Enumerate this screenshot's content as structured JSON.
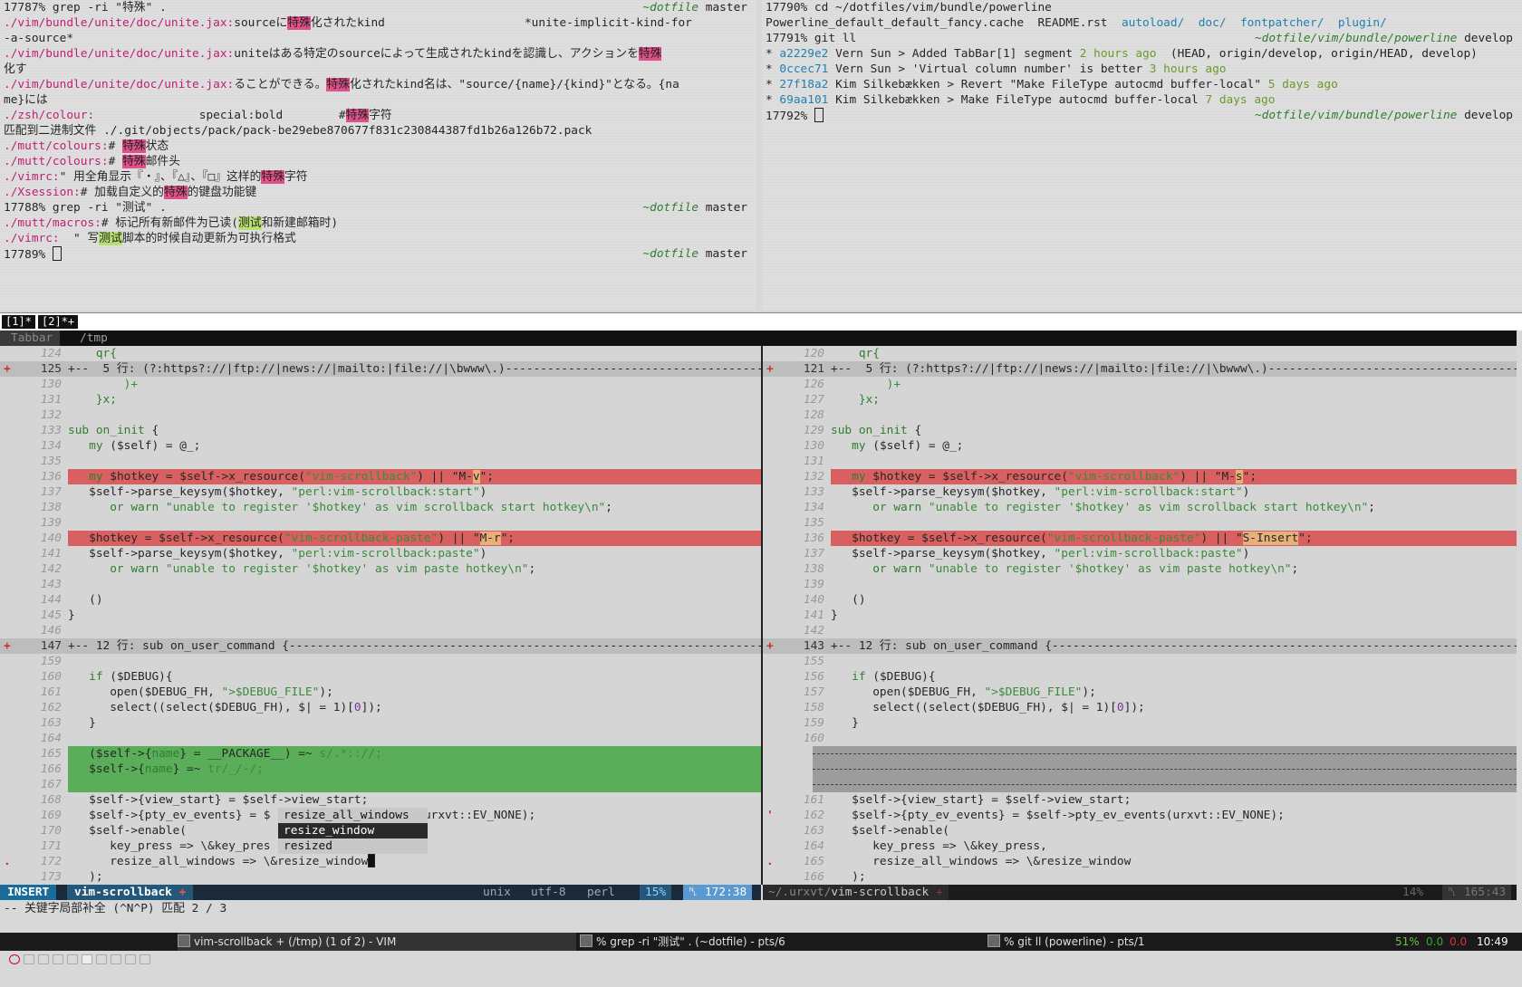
{
  "top_left_terminal": [
    [
      [
        "17787% grep -ri \"特殊\" .",
        ""
      ]
    ],
    [
      [
        "./vim/bundle/unite/doc/unite.jax:",
        "mag"
      ],
      [
        "source",
        ""
      ],
      [
        "に",
        ""
      ],
      [
        "特殊",
        "hl"
      ],
      [
        "化されたkind                    *unite-implicit-kind-for",
        ""
      ]
    ],
    [
      [
        "-a-source*",
        ""
      ]
    ],
    [
      [
        "./vim/bundle/unite/doc/unite.jax:",
        "mag"
      ],
      [
        "uniteはある特定のsourceによって生成されたkindを認識し、アクションを",
        ""
      ],
      [
        "特殊",
        "hl"
      ]
    ],
    [
      [
        "化す",
        ""
      ]
    ],
    [
      [
        "./vim/bundle/unite/doc/unite.jax:",
        "mag"
      ],
      [
        "ることができる。",
        ""
      ],
      [
        "特殊",
        "hl"
      ],
      [
        "化されたkind名は、\"source/{name}/{kind}\"となる。{na",
        ""
      ]
    ],
    [
      [
        "me}には",
        ""
      ]
    ],
    [
      [
        "./zsh/colour:",
        "mag"
      ],
      [
        "               special:bold        #",
        ""
      ],
      [
        "特殊",
        "hl"
      ],
      [
        "字符",
        ""
      ]
    ],
    [
      [
        "匹配到二进制文件 ./.git/objects/pack/pack-be29ebe870677f831c230844387fd1b26a126b72.pack",
        ""
      ]
    ],
    [
      [
        "./mutt/colours:",
        "mag"
      ],
      [
        "# ",
        ""
      ],
      [
        "特殊",
        "hl"
      ],
      [
        "状态",
        ""
      ]
    ],
    [
      [
        "./mutt/colours:",
        "mag"
      ],
      [
        "# ",
        ""
      ],
      [
        "特殊",
        "hl"
      ],
      [
        "邮件头",
        ""
      ]
    ],
    [
      [
        "./vimrc:",
        "mag"
      ],
      [
        "\" 用全角显示『・』、『△』、『□』这样的",
        ""
      ],
      [
        "特殊",
        "hl"
      ],
      [
        "字符",
        ""
      ]
    ],
    [
      [
        "./Xsession:",
        "mag"
      ],
      [
        "# 加载自定义的",
        ""
      ],
      [
        "特殊",
        "hl"
      ],
      [
        "的键盘功能键",
        ""
      ]
    ],
    [
      [
        "17788% grep -ri \"测试\" .",
        ""
      ]
    ],
    [
      [
        "./mutt/macros:",
        "mag"
      ],
      [
        "# 标记所有新邮件为已读(",
        ""
      ],
      [
        "测试",
        "hlg"
      ],
      [
        "和新建邮箱时)",
        ""
      ]
    ],
    [
      [
        "./vimrc:",
        "mag"
      ],
      [
        "  \" 写",
        ""
      ],
      [
        "测试",
        "hlg"
      ],
      [
        "脚本的时候自动更新为可执行格式",
        ""
      ]
    ],
    [
      [
        "17789% ",
        ""
      ]
    ]
  ],
  "top_left_prompts": {
    "1": "~dotfile master",
    "14": "~dotfile master",
    "17": "~dotfile master"
  },
  "top_left_branch": "master",
  "top_left_path": "~dotfile",
  "top_right_terminal": [
    [
      [
        "17790% cd ~/dotfiles/vim/bundle/powerline",
        ""
      ]
    ],
    [
      [
        "Powerline_default_default_fancy.cache  README.rst  ",
        ""
      ],
      [
        "autoload/",
        "cy"
      ],
      [
        "  ",
        ""
      ],
      [
        "doc/",
        "cy"
      ],
      [
        "  ",
        ""
      ],
      [
        "fontpatcher/",
        "cy"
      ],
      [
        "  ",
        ""
      ],
      [
        "plugin/",
        "cy"
      ]
    ],
    [
      [
        "17791% git ll",
        ""
      ]
    ],
    [
      [
        "* ",
        ""
      ],
      [
        "a2229e2",
        "hsh"
      ],
      [
        " Vern Sun > Added TabBar[1] segment ",
        ""
      ],
      [
        "2 hours ago",
        "dim"
      ],
      [
        "  (HEAD, origin/develop, origin/HEAD, develop)",
        "br"
      ]
    ],
    [
      [
        "* ",
        ""
      ],
      [
        "0ccec71",
        "hsh"
      ],
      [
        " Vern Sun > 'Virtual column number' is better ",
        ""
      ],
      [
        "3 hours ago",
        "dim"
      ]
    ],
    [
      [
        "* ",
        ""
      ],
      [
        "27f18a2",
        "hsh"
      ],
      [
        " Kim Silkebækken > Revert \"Make FileType autocmd buffer-local\" ",
        ""
      ],
      [
        "5 days ago",
        "dim"
      ]
    ],
    [
      [
        "* ",
        ""
      ],
      [
        "69aa101",
        "hsh"
      ],
      [
        " Kim Silkebækken > Make FileType autocmd buffer-local ",
        ""
      ],
      [
        "7 days ago",
        "dim"
      ]
    ],
    [
      [
        "17792% ",
        ""
      ]
    ]
  ],
  "top_right_prompts": {
    "3": "~dotfile/vim/bundle/powerline develop",
    "8": "~dotfile/vim/bundle/powerline develop"
  },
  "tabs": [
    "[1]*",
    "[2]*+"
  ],
  "tabbar": {
    "label": "Tabbar",
    "path": "/tmp"
  },
  "left_pane": [
    {
      "n": "124",
      "t": [
        [
          "    qr{",
          "kw"
        ]
      ]
    },
    {
      "n": "125",
      "s": "+",
      "fold": true,
      "t": [
        [
          "+--  5 行: (?:https?://|ftp://|news://|mailto:|file://|\\bwww\\.)-------------------------------------------",
          ""
        ]
      ]
    },
    {
      "n": "130",
      "t": [
        [
          "        )+",
          "str"
        ]
      ]
    },
    {
      "n": "131",
      "t": [
        [
          "    }x;",
          "kw"
        ]
      ]
    },
    {
      "n": "132",
      "t": []
    },
    {
      "n": "133",
      "t": [
        [
          "sub ",
          "kw"
        ],
        [
          "on_init",
          "kw"
        ],
        [
          " {",
          ""
        ]
      ]
    },
    {
      "n": "134",
      "t": [
        [
          "   my ",
          "kw"
        ],
        [
          "($self) = @_;",
          ""
        ]
      ]
    },
    {
      "n": "135",
      "t": []
    },
    {
      "n": "136",
      "chg": true,
      "t": [
        [
          "   my ",
          "kw"
        ],
        [
          "$hotkey = $self->x_resource(",
          ""
        ],
        [
          "\"vim-scrollback\"",
          "str"
        ],
        [
          ") || ",
          ""
        ],
        [
          "\"M-",
          ""
        ],
        [
          "v",
          "dhl"
        ],
        [
          "\";",
          ""
        ]
      ]
    },
    {
      "n": "137",
      "t": [
        [
          "   $self->parse_keysym($hotkey, ",
          ""
        ],
        [
          "\"perl:vim-scrollback:start\"",
          "str"
        ],
        [
          ")",
          ""
        ]
      ]
    },
    {
      "n": "138",
      "t": [
        [
          "      or warn ",
          "kw"
        ],
        [
          "\"unable to register '$hotkey' as vim scrollback start hotkey\\n\"",
          "str"
        ],
        [
          ";",
          ""
        ]
      ]
    },
    {
      "n": "139",
      "t": []
    },
    {
      "n": "140",
      "chg": true,
      "t": [
        [
          "   $hotkey = $self->x_resource(",
          ""
        ],
        [
          "\"vim-scrollback-paste\"",
          "str"
        ],
        [
          ") || ",
          ""
        ],
        [
          "\"",
          ""
        ],
        [
          "M-r",
          "dhl"
        ],
        [
          "\";",
          ""
        ]
      ]
    },
    {
      "n": "141",
      "t": [
        [
          "   $self->parse_keysym($hotkey, ",
          ""
        ],
        [
          "\"perl:vim-scrollback:paste\"",
          "str"
        ],
        [
          ")",
          ""
        ]
      ]
    },
    {
      "n": "142",
      "t": [
        [
          "      or warn ",
          "kw"
        ],
        [
          "\"unable to register '$hotkey' as vim paste hotkey\\n\"",
          "str"
        ],
        [
          ";",
          ""
        ]
      ]
    },
    {
      "n": "143",
      "t": []
    },
    {
      "n": "144",
      "t": [
        [
          "   ()",
          ""
        ]
      ]
    },
    {
      "n": "145",
      "t": [
        [
          "}",
          ""
        ]
      ]
    },
    {
      "n": "146",
      "t": []
    },
    {
      "n": "147",
      "s": "+",
      "fold": true,
      "t": [
        [
          "+-- 12 行: sub on_user_command {--------------------------------------------------------------------------",
          ""
        ]
      ]
    },
    {
      "n": "159",
      "t": []
    },
    {
      "n": "160",
      "t": [
        [
          "   if ",
          "kw"
        ],
        [
          "($DEBUG){",
          ""
        ]
      ]
    },
    {
      "n": "161",
      "t": [
        [
          "      open($DEBUG_FH, ",
          ""
        ],
        [
          "\">$DEBUG_FILE\"",
          "str"
        ],
        [
          ");",
          ""
        ]
      ]
    },
    {
      "n": "162",
      "t": [
        [
          "      select((select($DEBUG_FH), $| = 1)[",
          ""
        ],
        [
          "0",
          "lit"
        ],
        [
          "]);",
          ""
        ]
      ]
    },
    {
      "n": "163",
      "t": [
        [
          "   }",
          ""
        ]
      ]
    },
    {
      "n": "164",
      "t": []
    },
    {
      "n": "165",
      "add": true,
      "t": [
        [
          "   ($self->{",
          ""
        ],
        [
          "name",
          "kw"
        ],
        [
          "} = __PACKAGE__) =~ ",
          ""
        ],
        [
          "s/.*:://;",
          "str"
        ]
      ]
    },
    {
      "n": "166",
      "add": true,
      "t": [
        [
          "   $self->{",
          ""
        ],
        [
          "name",
          "kw"
        ],
        [
          "} =~ ",
          ""
        ],
        [
          "tr/_/-/;",
          "str"
        ]
      ]
    },
    {
      "n": "167",
      "add": true,
      "t": []
    },
    {
      "n": "168",
      "t": [
        [
          "   $self->{view_start} = $self->view_start;",
          ""
        ]
      ]
    },
    {
      "n": "169",
      "t": [
        [
          "   $self->{pty_ev_events} = $",
          ""
        ],
        [
          "                      ",
          ""
        ],
        [
          "urxvt::EV_NONE);",
          ""
        ]
      ]
    },
    {
      "n": "170",
      "t": [
        [
          "   $self->enable(",
          ""
        ]
      ]
    },
    {
      "n": "171",
      "t": [
        [
          "      key_press => \\&key_pres",
          ""
        ]
      ]
    },
    {
      "n": "172",
      "s": ".",
      "t": [
        [
          "      resize_all_windows => \\&resize_window",
          ""
        ]
      ]
    },
    {
      "n": "173",
      "t": [
        [
          "   );",
          ""
        ]
      ]
    }
  ],
  "right_pane": [
    {
      "n": "120",
      "t": [
        [
          "    qr{",
          "kw"
        ]
      ]
    },
    {
      "n": "121",
      "s": "+",
      "fold": true,
      "t": [
        [
          "+--  5 行: (?:https?://|ftp://|news://|mailto:|file://|\\bwww\\.)------------------------------------------",
          ""
        ]
      ]
    },
    {
      "n": "126",
      "t": [
        [
          "        )+",
          "str"
        ]
      ]
    },
    {
      "n": "127",
      "t": [
        [
          "    }x;",
          "kw"
        ]
      ]
    },
    {
      "n": "128",
      "t": []
    },
    {
      "n": "129",
      "t": [
        [
          "sub ",
          "kw"
        ],
        [
          "on_init",
          "kw"
        ],
        [
          " {",
          ""
        ]
      ]
    },
    {
      "n": "130",
      "t": [
        [
          "   my ",
          "kw"
        ],
        [
          "($self) = @_;",
          ""
        ]
      ]
    },
    {
      "n": "131",
      "t": []
    },
    {
      "n": "132",
      "chg": true,
      "t": [
        [
          "   my ",
          "kw"
        ],
        [
          "$hotkey = $self->x_resource(",
          ""
        ],
        [
          "\"vim-scrollback\"",
          "str"
        ],
        [
          ") || ",
          ""
        ],
        [
          "\"M-",
          ""
        ],
        [
          "s",
          "dhl"
        ],
        [
          "\";",
          ""
        ]
      ]
    },
    {
      "n": "133",
      "t": [
        [
          "   $self->parse_keysym($hotkey, ",
          ""
        ],
        [
          "\"perl:vim-scrollback:start\"",
          "str"
        ],
        [
          ")",
          ""
        ]
      ]
    },
    {
      "n": "134",
      "t": [
        [
          "      or warn ",
          "kw"
        ],
        [
          "\"unable to register '$hotkey' as vim scrollback start hotkey\\n\"",
          "str"
        ],
        [
          ";",
          ""
        ]
      ]
    },
    {
      "n": "135",
      "t": []
    },
    {
      "n": "136",
      "chg": true,
      "t": [
        [
          "   $hotkey = $self->x_resource(",
          ""
        ],
        [
          "\"vim-scrollback-paste\"",
          "str"
        ],
        [
          ") || ",
          ""
        ],
        [
          "\"",
          ""
        ],
        [
          "S-Insert",
          "dhl"
        ],
        [
          "\";",
          ""
        ]
      ]
    },
    {
      "n": "137",
      "t": [
        [
          "   $self->parse_keysym($hotkey, ",
          ""
        ],
        [
          "\"perl:vim-scrollback:paste\"",
          "str"
        ],
        [
          ")",
          ""
        ]
      ]
    },
    {
      "n": "138",
      "t": [
        [
          "      or warn ",
          "kw"
        ],
        [
          "\"unable to register '$hotkey' as vim paste hotkey\\n\"",
          "str"
        ],
        [
          ";",
          ""
        ]
      ]
    },
    {
      "n": "139",
      "t": []
    },
    {
      "n": "140",
      "t": [
        [
          "   ()",
          ""
        ]
      ]
    },
    {
      "n": "141",
      "t": [
        [
          "}",
          ""
        ]
      ]
    },
    {
      "n": "142",
      "t": []
    },
    {
      "n": "143",
      "s": "+",
      "fold": true,
      "t": [
        [
          "+-- 12 行: sub on_user_command {-------------------------------------------------------------------------",
          ""
        ]
      ]
    },
    {
      "n": "155",
      "t": []
    },
    {
      "n": "156",
      "t": [
        [
          "   if ",
          "kw"
        ],
        [
          "($DEBUG){",
          ""
        ]
      ]
    },
    {
      "n": "157",
      "t": [
        [
          "      open($DEBUG_FH, ",
          ""
        ],
        [
          "\">$DEBUG_FILE\"",
          "str"
        ],
        [
          ");",
          ""
        ]
      ]
    },
    {
      "n": "158",
      "t": [
        [
          "      select((select($DEBUG_FH), $| = 1)[",
          ""
        ],
        [
          "0",
          "lit"
        ],
        [
          "]);",
          ""
        ]
      ]
    },
    {
      "n": "159",
      "t": [
        [
          "   }",
          ""
        ]
      ]
    },
    {
      "n": "160",
      "t": []
    },
    {
      "n": "",
      "del": true,
      "t": []
    },
    {
      "n": "",
      "del": true,
      "t": []
    },
    {
      "n": "",
      "del": true,
      "t": []
    },
    {
      "n": "161",
      "t": [
        [
          "   $self->{view_start} = $self->view_start;",
          ""
        ]
      ]
    },
    {
      "n": "162",
      "s": "'",
      "t": [
        [
          "   $self->{pty_ev_events} = $self->pty_ev_events(urxvt::EV_NONE);",
          ""
        ]
      ]
    },
    {
      "n": "163",
      "t": [
        [
          "   $self->enable(",
          ""
        ]
      ]
    },
    {
      "n": "164",
      "t": [
        [
          "      key_press => \\&key_press,",
          ""
        ]
      ]
    },
    {
      "n": "165",
      "s": ".",
      "t": [
        [
          "      resize_all_windows => \\&resize_window",
          ""
        ]
      ]
    },
    {
      "n": "166",
      "t": [
        [
          "   );",
          ""
        ]
      ]
    }
  ],
  "popup_menu": [
    "resize_all_windows",
    "resize_window",
    "resized"
  ],
  "popup_selected": 1,
  "statusline_left": {
    "mode": "INSERT",
    "file": "vim-scrollback",
    "modified": "+",
    "format": "unix",
    "encoding": "utf-8",
    "filetype": "perl",
    "percent": "15%",
    "position": "172:38"
  },
  "statusline_right": {
    "dir": "~/.urxvt/",
    "file": "vim-scrollback",
    "modified": "+",
    "percent": "14%",
    "position": "165:43"
  },
  "cmdline": "-- 关键字局部补全 (^N^P) 匹配 2 / 3",
  "panel": {
    "task1": "vim-scrollback + (/tmp) (1 of 2) - VIM",
    "task2": "% grep -ri \"测试\" . (~dotfile) - pts/6",
    "task3": "% git ll (powerline) - pts/1",
    "cpu": "51%",
    "load1": "0.0",
    "load2": "0.0",
    "clock": "10:49"
  },
  "colors": {
    "diff_change": "#d86060",
    "diff_add": "#5aae5a",
    "diff_text": "#e7b07a",
    "grep_match": "#e0508a",
    "grep_match2": "#b8e070",
    "statusline_left": "#1b2a3a",
    "mode_bg": "#1a6a9a"
  }
}
